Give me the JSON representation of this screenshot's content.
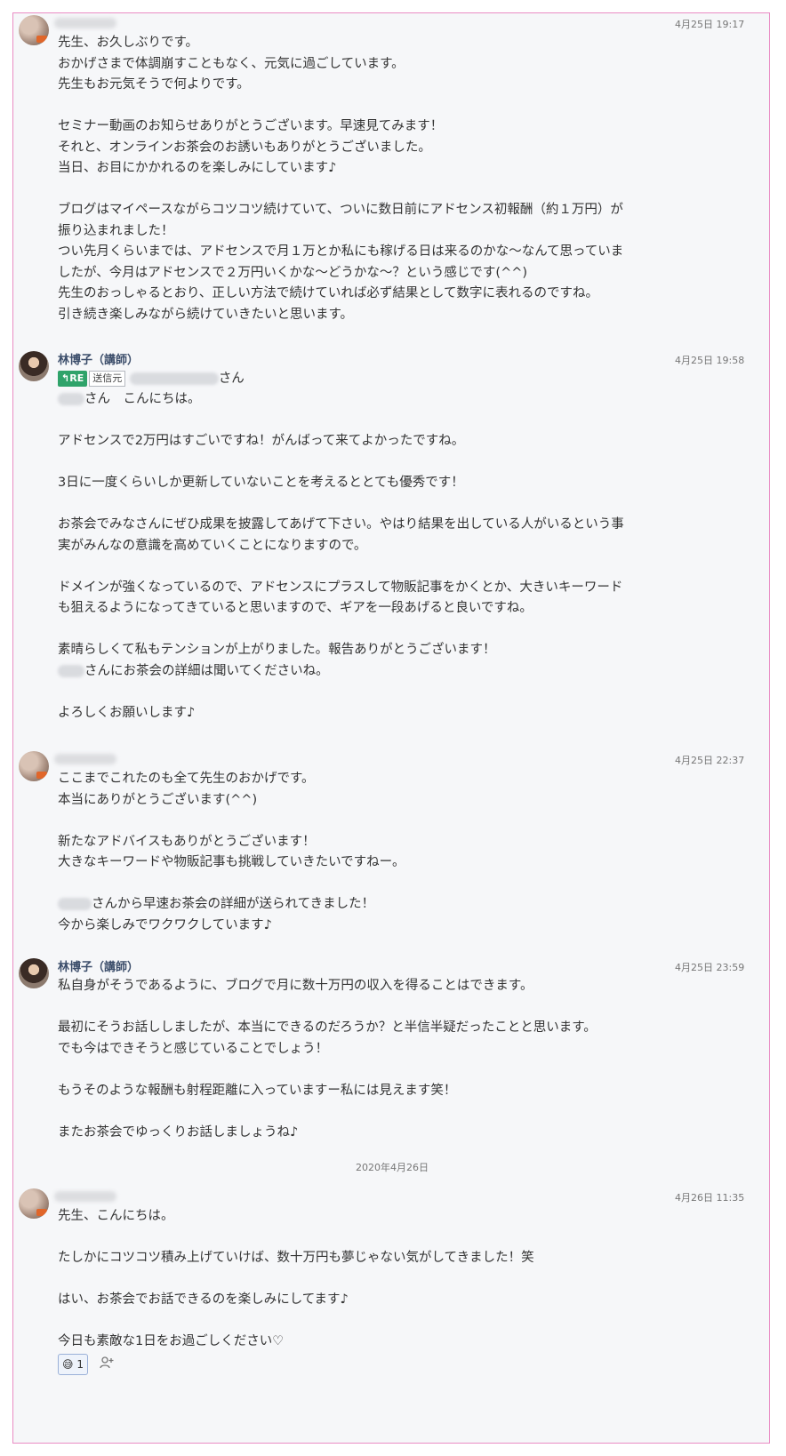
{
  "messages": [
    {
      "author": "",
      "time": "4月25日 19:17",
      "lines": [
        "先生、お久しぶりです。",
        "おかげさまで体調崩すこともなく、元気に過ごしています。",
        "先生もお元気そうで何よりです。",
        "",
        "セミナー動画のお知らせありがとうございます。早速見てみます！",
        "それと、オンラインお茶会のお誘いもありがとうございました。",
        "当日、お目にかかれるのを楽しみにしています♪",
        "",
        "ブログはマイペースながらコツコツ続けていて、ついに数日前にアドセンス初報酬（約１万円）が",
        "振り込まれました！",
        "つい先月くらいまでは、アドセンスで月１万とか私にも稼げる日は来るのかな～なんて思っていま",
        "したが、今月はアドセンスで２万円いくかな～どうかな～？という感じです(^^)",
        "先生のおっしゃるとおり、正しい方法で続けていれば必ず結果として数字に表れるのですね。",
        "引き続き楽しみながら続けていきたいと思います。"
      ]
    },
    {
      "author": "林博子（講師）",
      "time": "4月25日 19:58",
      "reply_badge": "RE",
      "reply_source": "送信元",
      "reply_suffix": "さん",
      "greeting": "さん　こんにちは。",
      "lines": [
        "",
        "アドセンスで2万円はすごいですね！がんばって来てよかったですね。",
        "",
        "3日に一度くらいしか更新していないことを考えるととても優秀です！",
        "",
        "お茶会でみなさんにぜひ成果を披露してあげて下さい。やはり結果を出している人がいるという事",
        "実がみんなの意識を高めていくことになりますので。",
        "",
        "ドメインが強くなっているので、アドセンスにプラスして物販記事をかくとか、大きいキーワード",
        "も狙えるようになってきていると思いますので、ギアを一段あげると良いですね。",
        "",
        "素晴らしくて私もテンションが上がりました。報告ありがとうございます！",
        "さんにお茶会の詳細は聞いてくださいね。",
        "",
        "よろしくお願いします♪"
      ]
    },
    {
      "author": "",
      "time": "4月25日 22:37",
      "lines": [
        "ここまでこれたのも全て先生のおかげです。",
        "本当にありがとうございます(^^)",
        "",
        "新たなアドバイスもありがとうございます！",
        "大きなキーワードや物販記事も挑戦していきたいですねー。",
        "",
        "さんから早速お茶会の詳細が送られてきました！",
        "今から楽しみでワクワクしています♪"
      ]
    },
    {
      "author": "林博子（講師）",
      "time": "4月25日 23:59",
      "lines": [
        "私自身がそうであるように、ブログで月に数十万円の収入を得ることはできます。",
        "",
        "最初にそうお話ししましたが、本当にできるのだろうか？と半信半疑だったことと思います。",
        "でも今はできそうと感じていることでしょう！",
        "",
        "もうそのような報酬も射程距離に入っていますー私には見えます笑！",
        "",
        "またお茶会でゆっくりお話しましょうね♪"
      ]
    },
    {
      "author": "",
      "time": "4月26日 11:35",
      "lines": [
        "先生、こんにちは。",
        "",
        "たしかにコツコツ積み上げていけば、数十万円も夢じゃない気がしてきました！笑",
        "",
        "はい、お茶会でお話できるのを楽しみにしてます♪",
        "",
        "今日も素敵な1日をお過ごしください♡"
      ]
    }
  ],
  "date_separator": "2020年4月26日",
  "reaction": {
    "emoji": "😅",
    "count": "1"
  }
}
